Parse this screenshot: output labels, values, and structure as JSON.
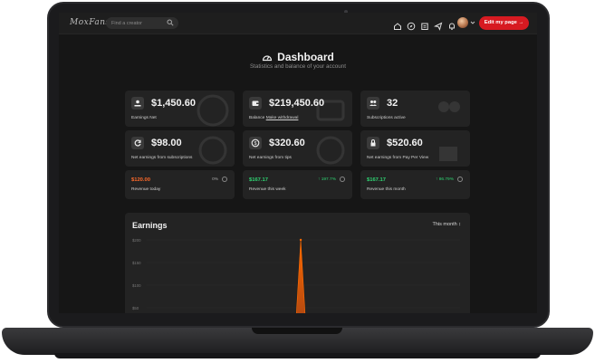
{
  "app": {
    "logo": "MoxFans",
    "search_placeholder": "Find a creator",
    "edit_button": "Edit my page →",
    "nav_icons": [
      "home-icon",
      "compass-icon",
      "calendar-icon",
      "send-icon",
      "bell-icon"
    ]
  },
  "header": {
    "title": "Dashboard",
    "subtitle": "Statistics and balance of your account"
  },
  "cards": [
    {
      "value": "$1,450.60",
      "label": "Earnings Net",
      "icon": "earnings-icon"
    },
    {
      "value": "$219,450.60",
      "label": "Balance",
      "link": "Make withdrawal",
      "icon": "wallet-icon"
    },
    {
      "value": "32",
      "label": "Subscriptions active",
      "icon": "users-icon"
    },
    {
      "value": "$98.00",
      "label": "Net earnings from subscriptions",
      "icon": "refresh-icon"
    },
    {
      "value": "$320.60",
      "label": "Net earnings from tips",
      "icon": "coin-icon"
    },
    {
      "value": "$520.60",
      "label": "Net earnings from Pay Per View",
      "icon": "lock-icon"
    }
  ],
  "revenue": [
    {
      "amount": "$120.00",
      "pct": "0%",
      "label": "Revenue today",
      "color": "#ff6a2a"
    },
    {
      "amount": "$167.17",
      "pct": "↑ 197.7%",
      "label": "Revenue this week",
      "color": "#2fd573"
    },
    {
      "amount": "$167.17",
      "pct": "↑ 86.79%",
      "label": "Revenue this month",
      "color": "#2fd573"
    }
  ],
  "earnings": {
    "title": "Earnings",
    "period": "This month ↕"
  },
  "chart_data": {
    "type": "area",
    "title": "Earnings",
    "y_ticks": [
      "$200",
      "$150",
      "$100",
      "$50"
    ],
    "ylim": [
      0,
      200
    ],
    "series": [
      {
        "values": [
          0,
          0,
          0,
          0,
          0,
          0,
          0,
          0,
          0,
          0,
          0,
          0,
          0,
          0,
          0,
          0,
          0,
          0,
          0,
          0,
          0,
          0,
          0,
          0,
          0,
          0,
          0,
          0,
          0,
          200,
          0,
          0,
          0,
          0,
          0,
          0,
          0,
          0,
          0,
          0,
          0,
          0,
          0,
          0,
          0,
          0,
          0,
          0,
          0,
          0,
          0,
          0,
          0,
          0,
          0,
          0,
          0,
          0,
          0,
          0
        ]
      }
    ],
    "colors": {
      "line": "#ff6a00",
      "fill": "#c04a10"
    }
  }
}
